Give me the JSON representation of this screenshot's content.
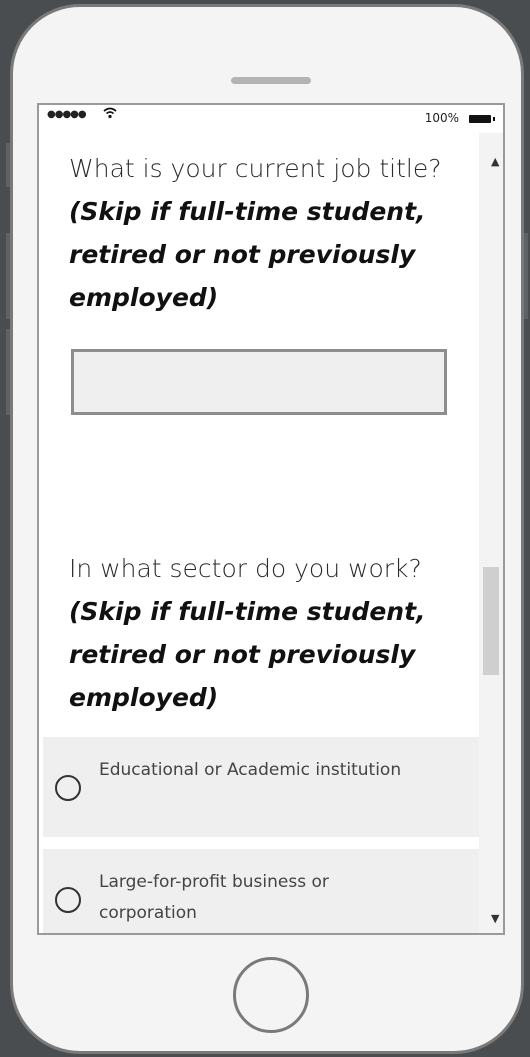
{
  "status_bar": {
    "signal": "●●●●●",
    "wifi_icon": "wifi-icon",
    "battery_text": "100%"
  },
  "question1": {
    "text": "What is your current job title? ",
    "note": "(Skip if full-time student, retired or not previously employed)"
  },
  "job_title_input": {
    "value": "",
    "placeholder": ""
  },
  "question2": {
    "text": "In what sector do you work? ",
    "note": "(Skip if full-time student, retired or not previously employed)"
  },
  "options": [
    {
      "label": "Educational or Academic institution",
      "selected": false
    },
    {
      "label": "Large-for-profit business or corporation",
      "selected": false
    }
  ],
  "colors": {
    "background": "#4a4d4f",
    "phone_body": "#f4f4f4",
    "option_bg": "#efefef",
    "input_border": "#8d8d8d"
  }
}
